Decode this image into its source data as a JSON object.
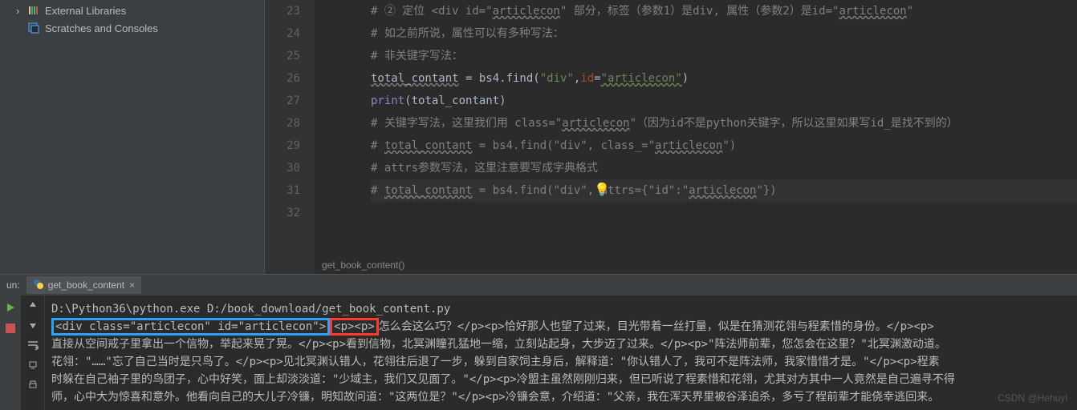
{
  "sidebar": {
    "external_libraries": "External Libraries",
    "scratches": "Scratches and Consoles"
  },
  "gutter_lines": [
    "23",
    "24",
    "25",
    "26",
    "27",
    "28",
    "29",
    "30",
    "31",
    "32"
  ],
  "code": {
    "l23_a": "# ② 定位 <div id=\"",
    "l23_b": "articlecon",
    "l23_c": "\" 部分，标签（参数1）是div, 属性（参数2）是id=\"",
    "l23_d": "articlecon",
    "l23_e": "\"",
    "l24": "# 如之前所说，属性可以有多种写法：",
    "l25": "# 非关键字写法：",
    "l26_var": "total_contant",
    "l26_eq": " = bs4.find(",
    "l26_s1": "\"div\"",
    "l26_c": ",",
    "l26_id": "id",
    "l26_eq2": "=",
    "l26_s2": "\"articlecon\"",
    "l26_end": ")",
    "l27_print": "print",
    "l27_arg": "(total_contant)",
    "l28_a": "# 关键字写法，这里我们用 class=\"",
    "l28_b": "articlecon",
    "l28_c": "\"（因为id不是python关键字，所以这里如果写id_是找不到的）",
    "l29_a": "# ",
    "l29_b": "total_contant",
    "l29_c": " = bs4.find(\"div\", class_=\"",
    "l29_d": "articlecon",
    "l29_e": "\")",
    "l30": "# attrs参数写法，这里注意要写成字典格式",
    "l31_a": "# ",
    "l31_b": "total_contant",
    "l31_c": " = bs4.find(\"div\", attrs={\"id\":\"",
    "l31_d": "articlecon",
    "l31_e": "\"})"
  },
  "breadcrumb": "get_book_content()",
  "run": {
    "panel_label": "un:",
    "tab_name": "get_book_content",
    "cmd": "D:\\Python36\\python.exe D:/book_download/get_book_content.py",
    "hl_blue": "<div class=\"articlecon\" id=\"articlecon\">",
    "hl_red": "<p><p>",
    "rest1": "怎么会这么巧？</p><p>恰好那人也望了过来，目光带着一丝打量，似是在猜测花翎与程素惜的身份。</p><p>",
    "line3": "直接从空间戒子里拿出一个信物，举起来晃了晃。</p><p>看到信物，北冥渊瞳孔猛地一缩，立刻站起身，大步迈了过来。</p><p>\"阵法师前辈，您怎会在这里？\"北冥渊激动道。",
    "line4": "花翎：\"……\"忘了自己当时是只鸟了。</p><p>见北冥渊认错人，花翎往后退了一步，躲到自家饲主身后，解释道：\"你认错人了，我可不是阵法师，我家惜惜才是。\"</p><p>程素",
    "line5": "时躲在自己袖子里的鸟团子，心中好笑，面上却淡淡道：\"少域主，我们又见面了。\"</p><p>冷盟主虽然刚刚归来，但已听说了程素惜和花翎，尤其对方其中一人竟然是自己遍寻不得",
    "line6": "师，心中大为惊喜和意外。他看向自己的大儿子冷镰，明知故问道：\"这两位是？\"</p><p>冷镰会意，介绍道：\"父亲，我在浑天界里被谷泽追杀，多亏了程前辈才能侥幸逃回来。"
  },
  "watermark": "CSDN @Hehuyi"
}
